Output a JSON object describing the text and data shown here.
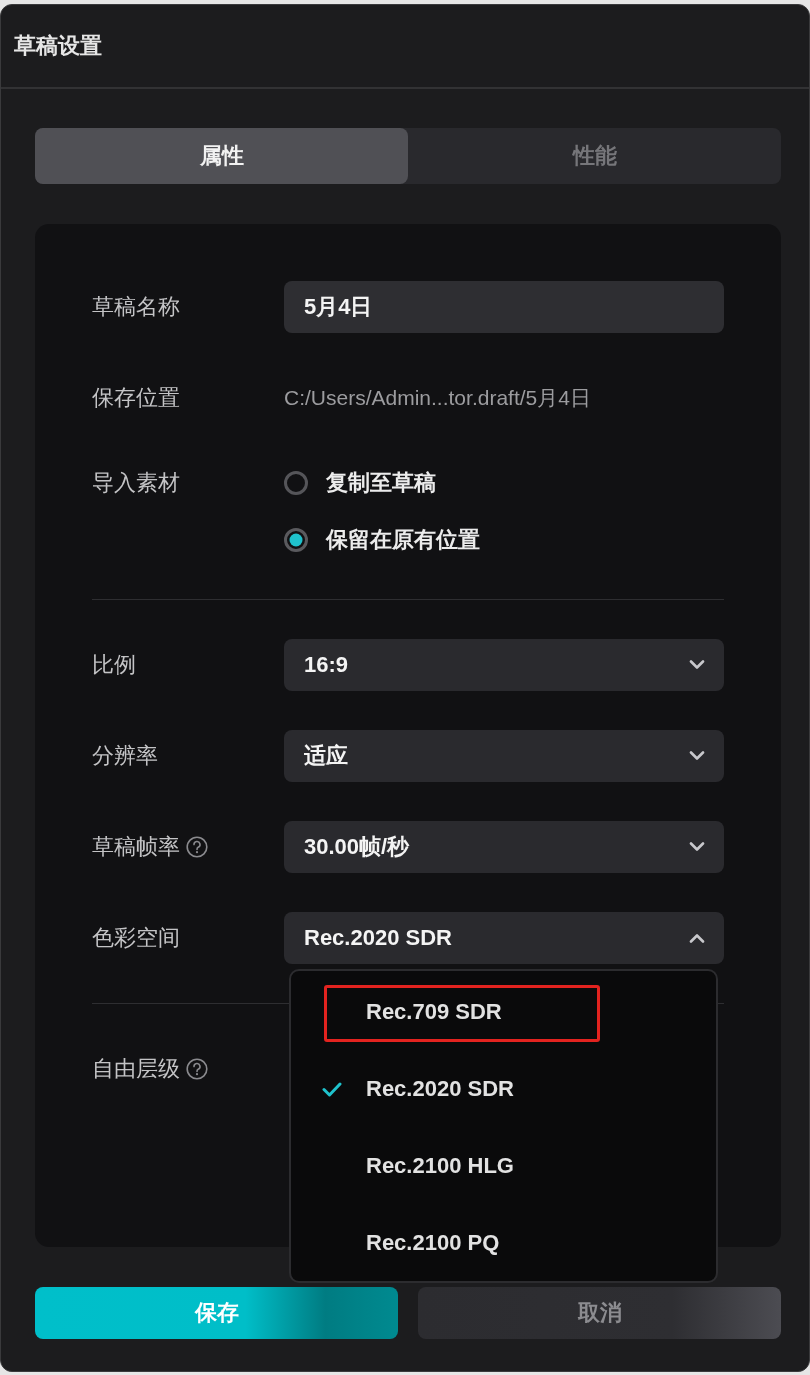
{
  "window": {
    "title": "草稿设置"
  },
  "tabs": [
    {
      "label": "属性",
      "selected": true
    },
    {
      "label": "性能",
      "selected": false
    }
  ],
  "form": {
    "sections": [
      {
        "fields": [
          {
            "kind": "text",
            "label": "草稿名称",
            "value": "5月4日"
          },
          {
            "kind": "path",
            "label": "保存位置",
            "value": "C:/Users/Admin...tor.draft/5月4日"
          },
          {
            "kind": "radio",
            "label": "导入素材",
            "options": [
              {
                "label": "复制至草稿",
                "selected": false
              },
              {
                "label": "保留在原有位置",
                "selected": true
              }
            ]
          }
        ]
      },
      {
        "fields": [
          {
            "kind": "select",
            "label": "比例",
            "value": "16:9",
            "expanded": false
          },
          {
            "kind": "select",
            "label": "分辨率",
            "value": "适应",
            "expanded": false
          },
          {
            "kind": "select",
            "label": "草稿帧率",
            "help": true,
            "value": "30.00帧/秒",
            "expanded": false
          },
          {
            "kind": "select",
            "label": "色彩空间",
            "value": "Rec.2020 SDR",
            "expanded": true,
            "options": [
              {
                "label": "Rec.709 SDR",
                "selected": false,
                "highlighted": true
              },
              {
                "label": "Rec.2020 SDR",
                "selected": true,
                "highlighted": false
              },
              {
                "label": "Rec.2100 HLG",
                "selected": false,
                "highlighted": false
              },
              {
                "label": "Rec.2100 PQ",
                "selected": false,
                "highlighted": false
              }
            ]
          }
        ]
      },
      {
        "fields": [
          {
            "kind": "covered",
            "label": "自由层级",
            "help": true
          }
        ]
      }
    ]
  },
  "buttons": [
    {
      "label": "保存",
      "kind": "primary"
    },
    {
      "label": "取消",
      "kind": "secondary"
    }
  ]
}
